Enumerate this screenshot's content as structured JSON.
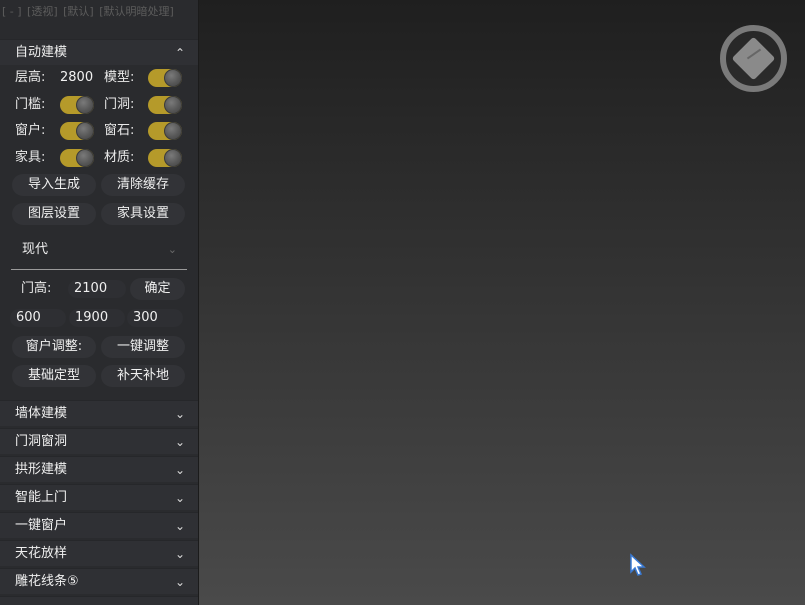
{
  "breadcrumbs": [
    "[ - ]",
    "[透视]",
    "[默认]",
    "[默认明暗处理]"
  ],
  "auto_model": {
    "title": "自动建模",
    "floor_height_label": "层高:",
    "floor_height_value": "2800",
    "model_label": "模型:",
    "door_sill_label": "门槛:",
    "door_hole_label": "门洞:",
    "window_label": "窗户:",
    "window_stone_label": "窗石:",
    "furniture_label": "家具:",
    "material_label": "材质:",
    "import_btn": "导入生成",
    "clear_cache_btn": "清除缓存",
    "layer_settings_btn": "图层设置",
    "furniture_settings_btn": "家具设置",
    "style_select": "现代",
    "door_height_label": "门高:",
    "door_height_value": "2100",
    "confirm_btn": "确定",
    "field_a": "600",
    "field_b": "1900",
    "field_c": "300",
    "window_adjust_label": "窗户调整:",
    "one_click_adjust_btn": "一键调整",
    "base_shape_btn": "基础定型",
    "patch_btn": "补天补地"
  },
  "sections": [
    {
      "label": "墙体建模"
    },
    {
      "label": "门洞窗洞"
    },
    {
      "label": "拱形建模"
    },
    {
      "label": "智能上门"
    },
    {
      "label": "一键窗户"
    },
    {
      "label": "天花放样"
    },
    {
      "label": "雕花线条⑤"
    }
  ],
  "colors": {
    "toggle_on": "#b59a2a",
    "panel_bg": "#2a2b2e",
    "viewport_top": "#1f1f1f",
    "viewport_bottom": "#4a4a4a"
  },
  "icons": {
    "collapse": "chevron-up-icon",
    "expand": "chevron-down-icon",
    "viewcube": "viewcube-icon",
    "cursor": "mouse-cursor-icon"
  }
}
